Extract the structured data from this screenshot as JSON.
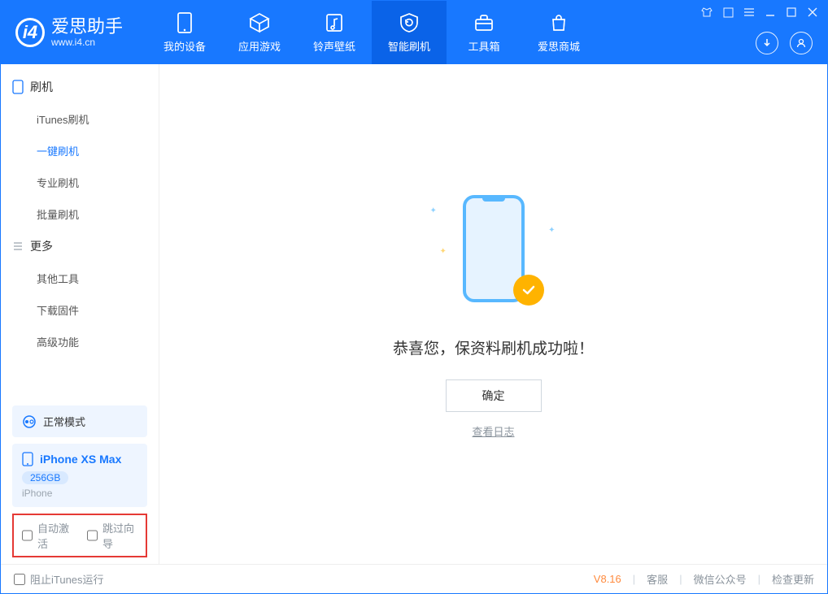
{
  "app": {
    "name": "爱思助手",
    "url": "www.i4.cn"
  },
  "nav": {
    "items": [
      {
        "label": "我的设备"
      },
      {
        "label": "应用游戏"
      },
      {
        "label": "铃声壁纸"
      },
      {
        "label": "智能刷机"
      },
      {
        "label": "工具箱"
      },
      {
        "label": "爱思商城"
      }
    ],
    "active_index": 3
  },
  "sidebar": {
    "group1": {
      "title": "刷机",
      "items": [
        "iTunes刷机",
        "一键刷机",
        "专业刷机",
        "批量刷机"
      ],
      "active_index": 1
    },
    "group2": {
      "title": "更多",
      "items": [
        "其他工具",
        "下载固件",
        "高级功能"
      ]
    },
    "mode": {
      "label": "正常模式"
    },
    "device": {
      "name": "iPhone XS Max",
      "storage": "256GB",
      "type": "iPhone"
    },
    "flags": {
      "auto_activate": "自动激活",
      "skip_guide": "跳过向导"
    }
  },
  "main": {
    "success_title": "恭喜您，保资料刷机成功啦！",
    "ok_button": "确定",
    "view_log": "查看日志"
  },
  "footer": {
    "block_itunes": "阻止iTunes运行",
    "version": "V8.16",
    "links": [
      "客服",
      "微信公众号",
      "检查更新"
    ]
  }
}
